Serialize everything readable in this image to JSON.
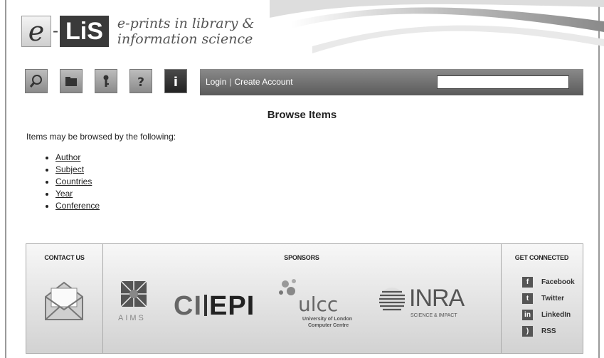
{
  "brand": {
    "logo_e": "e",
    "logo_dash": "-",
    "logo_lis": "LiS",
    "tagline_line1": "e-prints in library &",
    "tagline_line2": "information science"
  },
  "toolbar": {
    "icons": [
      "search-icon",
      "folder-icon",
      "key-icon",
      "help-icon",
      "info-icon"
    ]
  },
  "nav": {
    "login": "Login",
    "separator": "|",
    "create_account": "Create Account",
    "search_value": ""
  },
  "main": {
    "title": "Browse Items",
    "intro": "Items may be browsed by the following:",
    "browse_items": [
      "Author",
      "Subject",
      "Countries",
      "Year",
      "Conference"
    ]
  },
  "footer": {
    "contact_heading": "CONTACT US",
    "sponsors_heading": "SPONSORS",
    "social_heading": "GET CONNECTED",
    "sponsors": {
      "aims": "AIMS",
      "ciepi_a": "CI",
      "ciepi_b": "EPI",
      "ulcc_logo": "ulcc",
      "ulcc_line1": "University of London",
      "ulcc_line2": "Computer Centre",
      "inra": "INRA",
      "inra_tag": "SCIENCE & IMPACT"
    },
    "social": [
      {
        "label": "Facebook",
        "icon": "facebook-icon",
        "glyph": "f"
      },
      {
        "label": "Twitter",
        "icon": "twitter-icon",
        "glyph": "t"
      },
      {
        "label": "LinkedIn",
        "icon": "linkedin-icon",
        "glyph": "in"
      },
      {
        "label": "RSS",
        "icon": "rss-icon",
        "glyph": ")"
      }
    ]
  }
}
